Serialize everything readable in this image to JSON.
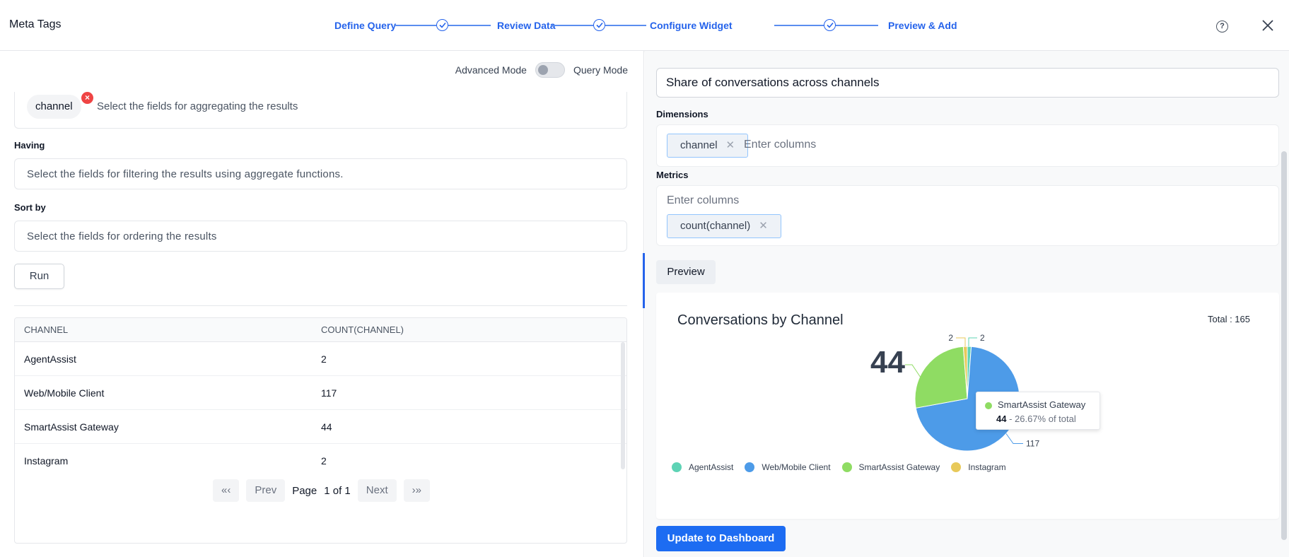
{
  "header": {
    "title": "Meta Tags",
    "steps": [
      "Define Query",
      "Review Data",
      "Configure Widget",
      "Preview & Add"
    ]
  },
  "left": {
    "mode": {
      "advanced": "Advanced Mode",
      "query": "Query Mode"
    },
    "group_by": {
      "chip": "channel",
      "placeholder": "Select the fields for aggregating the results"
    },
    "having": {
      "label": "Having",
      "placeholder": "Select the fields for filtering the results using aggregate functions."
    },
    "sort_by": {
      "label": "Sort by",
      "placeholder": "Select the fields for ordering the results"
    },
    "run_label": "Run",
    "table": {
      "columns": [
        "CHANNEL",
        "COUNT(CHANNEL)"
      ],
      "rows": [
        [
          "AgentAssist",
          "2"
        ],
        [
          "Web/Mobile Client",
          "117"
        ],
        [
          "SmartAssist Gateway",
          "44"
        ],
        [
          "Instagram",
          "2"
        ]
      ]
    },
    "pager": {
      "first": "«‹",
      "prev": "Prev",
      "page_label": "Page",
      "page_value": "1 of 1",
      "next": "Next",
      "last": "›»"
    }
  },
  "right": {
    "widget_title": "Share of conversations across channels",
    "dimensions": {
      "label": "Dimensions",
      "tag": "channel",
      "placeholder": "Enter columns"
    },
    "metrics": {
      "label": "Metrics",
      "placeholder": "Enter columns",
      "tag": "count(channel)"
    },
    "preview_tab": "Preview",
    "update_button": "Update to Dashboard"
  },
  "chart_data": {
    "type": "pie",
    "title": "Conversations by Channel",
    "total_label": "Total : 165",
    "categories": [
      "AgentAssist",
      "Web/Mobile Client",
      "SmartAssist Gateway",
      "Instagram"
    ],
    "values": [
      2,
      117,
      44,
      2
    ],
    "colors": [
      "#5ed3b5",
      "#4d9be8",
      "#8fdc63",
      "#e8c95a"
    ],
    "slice_labels": [
      "2",
      "117",
      "44",
      "2"
    ],
    "highlight_value": "44",
    "tooltip": {
      "name": "SmartAssist Gateway",
      "value": "44",
      "detail": " - 26.67% of total"
    },
    "legend_position": "bottom-left"
  }
}
